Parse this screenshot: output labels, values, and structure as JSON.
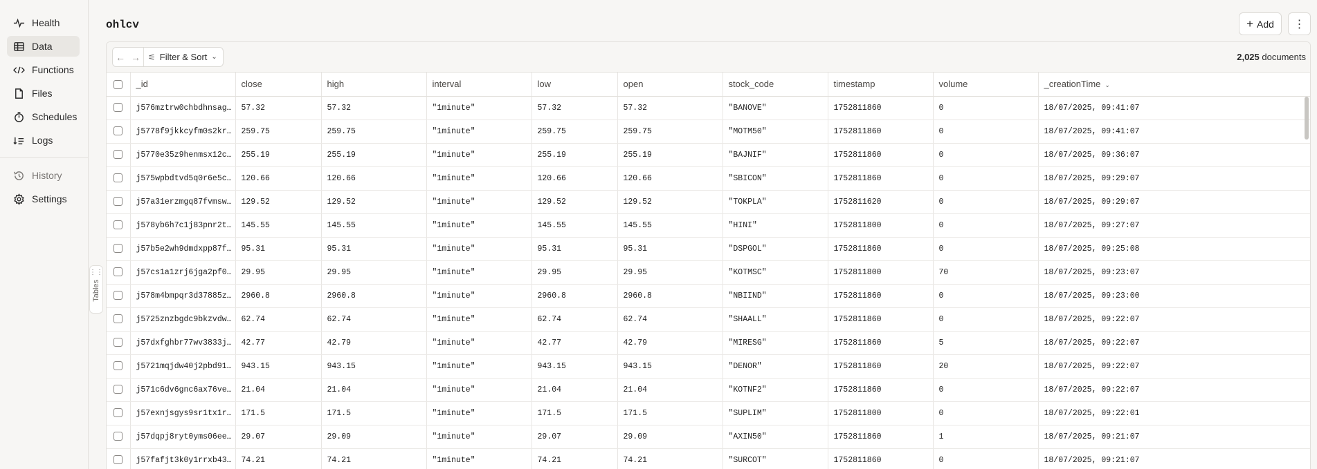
{
  "nav": {
    "items": [
      {
        "label": "Health",
        "icon": "health-pulse-icon"
      },
      {
        "label": "Data",
        "icon": "table-grid-icon"
      },
      {
        "label": "Functions",
        "icon": "code-brackets-icon"
      },
      {
        "label": "Files",
        "icon": "file-icon"
      },
      {
        "label": "Schedules",
        "icon": "stopwatch-icon"
      },
      {
        "label": "Logs",
        "icon": "logs-list-icon"
      }
    ],
    "secondary": [
      {
        "label": "History",
        "icon": "history-icon"
      },
      {
        "label": "Settings",
        "icon": "gear-icon"
      }
    ],
    "active": "Data"
  },
  "tables_handle": {
    "label": "Tables"
  },
  "header": {
    "title": "ohlcv",
    "add_label": "Add",
    "more_icon": "more-vertical-icon"
  },
  "toolbar": {
    "back_icon": "arrow-left-icon",
    "forward_icon": "arrow-right-icon",
    "filter_label": "Filter & Sort",
    "doc_count": "2,025",
    "doc_count_suffix": "documents"
  },
  "table": {
    "columns": [
      "_id",
      "close",
      "high",
      "interval",
      "low",
      "open",
      "stock_code",
      "timestamp",
      "volume",
      "_creationTime"
    ],
    "sorted_column": "_creationTime",
    "rows": [
      [
        "j576mztrw0chbdhnsag…",
        "57.32",
        "57.32",
        "\"1minute\"",
        "57.32",
        "57.32",
        "\"BANOVE\"",
        "1752811860",
        "0",
        "18/07/2025, 09:41:07"
      ],
      [
        "j5778f9jkkcyfm0s2kr…",
        "259.75",
        "259.75",
        "\"1minute\"",
        "259.75",
        "259.75",
        "\"MOTM50\"",
        "1752811860",
        "0",
        "18/07/2025, 09:41:07"
      ],
      [
        "j5770e35z9henmsx12c…",
        "255.19",
        "255.19",
        "\"1minute\"",
        "255.19",
        "255.19",
        "\"BAJNIF\"",
        "1752811860",
        "0",
        "18/07/2025, 09:36:07"
      ],
      [
        "j575wpbdtvd5q0r6e5c…",
        "120.66",
        "120.66",
        "\"1minute\"",
        "120.66",
        "120.66",
        "\"SBICON\"",
        "1752811860",
        "0",
        "18/07/2025, 09:29:07"
      ],
      [
        "j57a31erzmgq87fvmsw…",
        "129.52",
        "129.52",
        "\"1minute\"",
        "129.52",
        "129.52",
        "\"TOKPLA\"",
        "1752811620",
        "0",
        "18/07/2025, 09:29:07"
      ],
      [
        "j578yb6h7c1j83pnr2t…",
        "145.55",
        "145.55",
        "\"1minute\"",
        "145.55",
        "145.55",
        "\"HINI\"",
        "1752811800",
        "0",
        "18/07/2025, 09:27:07"
      ],
      [
        "j57b5e2wh9dmdxpp87f…",
        "95.31",
        "95.31",
        "\"1minute\"",
        "95.31",
        "95.31",
        "\"DSPGOL\"",
        "1752811860",
        "0",
        "18/07/2025, 09:25:08"
      ],
      [
        "j57cs1a1zrj6jga2pf0…",
        "29.95",
        "29.95",
        "\"1minute\"",
        "29.95",
        "29.95",
        "\"KOTMSC\"",
        "1752811800",
        "70",
        "18/07/2025, 09:23:07"
      ],
      [
        "j578m4bmpqr3d37885z…",
        "2960.8",
        "2960.8",
        "\"1minute\"",
        "2960.8",
        "2960.8",
        "\"NBIIND\"",
        "1752811860",
        "0",
        "18/07/2025, 09:23:00"
      ],
      [
        "j5725znzbgdc9bkzvdw…",
        "62.74",
        "62.74",
        "\"1minute\"",
        "62.74",
        "62.74",
        "\"SHAALL\"",
        "1752811860",
        "0",
        "18/07/2025, 09:22:07"
      ],
      [
        "j57dxfghbr77wv3833j…",
        "42.77",
        "42.79",
        "\"1minute\"",
        "42.77",
        "42.79",
        "\"MIRESG\"",
        "1752811860",
        "5",
        "18/07/2025, 09:22:07"
      ],
      [
        "j5721mqjdw40j2pbd91…",
        "943.15",
        "943.15",
        "\"1minute\"",
        "943.15",
        "943.15",
        "\"DENOR\"",
        "1752811860",
        "20",
        "18/07/2025, 09:22:07"
      ],
      [
        "j571c6dv6gnc6ax76ve…",
        "21.04",
        "21.04",
        "\"1minute\"",
        "21.04",
        "21.04",
        "\"KOTNF2\"",
        "1752811860",
        "0",
        "18/07/2025, 09:22:07"
      ],
      [
        "j57exnjsgys9sr1tx1r…",
        "171.5",
        "171.5",
        "\"1minute\"",
        "171.5",
        "171.5",
        "\"SUPLIM\"",
        "1752811800",
        "0",
        "18/07/2025, 09:22:01"
      ],
      [
        "j57dqpj8ryt0yms06ee…",
        "29.07",
        "29.09",
        "\"1minute\"",
        "29.07",
        "29.09",
        "\"AXIN50\"",
        "1752811860",
        "1",
        "18/07/2025, 09:21:07"
      ],
      [
        "j57fafjt3k0y1rrxb43…",
        "74.21",
        "74.21",
        "\"1minute\"",
        "74.21",
        "74.21",
        "\"SURCOT\"",
        "1752811860",
        "0",
        "18/07/2025, 09:21:07"
      ]
    ]
  }
}
